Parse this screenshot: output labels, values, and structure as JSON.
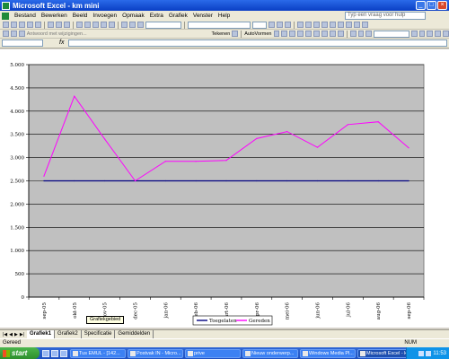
{
  "window": {
    "title": "Microsoft Excel - km mini"
  },
  "menubar": {
    "items": [
      "Bestand",
      "Bewerken",
      "Beeld",
      "Invoegen",
      "Opmaak",
      "Extra",
      "Grafiek",
      "Venster",
      "Help"
    ],
    "ask_placeholder": "Typ een vraag voor hulp"
  },
  "toolbar": {
    "reply_label": "Antwoord met wijzigingen...",
    "draw_label": "Tekenen",
    "autoshapes_label": "AutoVormen"
  },
  "formula": {
    "fx_label": "fx"
  },
  "chart_data": {
    "type": "line",
    "categories": [
      "sep-05",
      "okt-05",
      "nov-05",
      "dec-05",
      "jan-06",
      "feb-06",
      "mrt-06",
      "apr-06",
      "mei-06",
      "jun-06",
      "jul-06",
      "aug-06",
      "sep-06"
    ],
    "y_tick_labels": [
      "0",
      "500",
      "1.000",
      "1.500",
      "2.000",
      "2.500",
      "3.000",
      "3.500",
      "4.000",
      "4.500",
      "5.000"
    ],
    "ylim": [
      0,
      5000
    ],
    "grid": true,
    "legend": "bottom",
    "series": [
      {
        "name": "Toegelaten",
        "color": "#000080",
        "values": [
          2500,
          2500,
          2500,
          2500,
          2500,
          2500,
          2500,
          2500,
          2500,
          2500,
          2500,
          2500,
          2500
        ]
      },
      {
        "name": "Gereden",
        "color": "#ff00ff",
        "values": [
          2600,
          4320,
          3400,
          2500,
          2920,
          2920,
          2940,
          3410,
          3560,
          3220,
          3710,
          3770,
          3210
        ]
      }
    ],
    "plot_background": "#c0c0c0"
  },
  "tooltip": "Grafiekgebied",
  "sheet_tabs": [
    "Grafiek1",
    "Grafiek2",
    "Specificatie",
    "Gemiddelden"
  ],
  "status": {
    "text": "Gereed",
    "num": "NUM"
  },
  "taskbar": {
    "start_label": "start",
    "tasks": [
      "Tus EMUL - [142...",
      "Postvak IN - Micro...",
      "prive",
      "Nieuw onderwerp...",
      "Windows Media Pl...",
      "Microsoft Excel - k..."
    ],
    "clock": "11:53"
  }
}
